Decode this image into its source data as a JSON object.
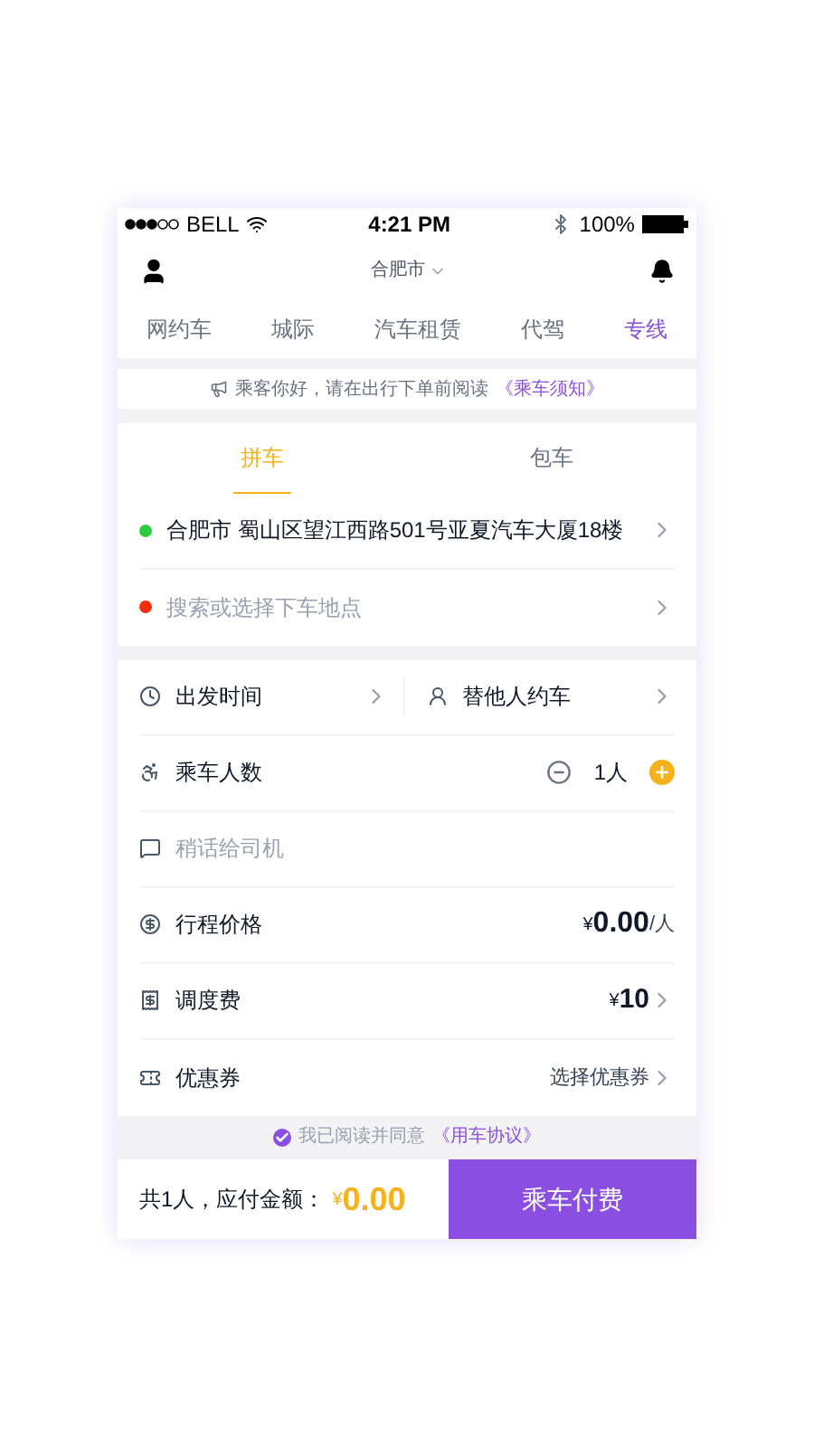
{
  "status_bar": {
    "carrier": "BELL",
    "time": "4:21 PM",
    "battery": "100%"
  },
  "header": {
    "city": "合肥市"
  },
  "service_tabs": [
    {
      "label": "网约车",
      "selected": false
    },
    {
      "label": "城际",
      "selected": false
    },
    {
      "label": "汽车租赁",
      "selected": false
    },
    {
      "label": "代驾",
      "selected": false
    },
    {
      "label": "专线",
      "selected": true
    }
  ],
  "notice": {
    "text": "乘客你好，请在出行下单前阅读",
    "link": "《乘车须知》"
  },
  "ride_tabs": [
    {
      "label": "拼车",
      "selected": true
    },
    {
      "label": "包车",
      "selected": false
    }
  ],
  "route": [
    {
      "text": "合肥市 蜀山区望江西路501号亚夏汽车大厦18楼",
      "placeholder": false,
      "color": "#2ecc40"
    },
    {
      "text": "搜索或选择下车地点",
      "placeholder": true,
      "color": "#f0300a"
    }
  ],
  "options": {
    "departure": "出发时间",
    "for_others": "替他人约车"
  },
  "passengers": {
    "label": "乘车人数",
    "count": "1人"
  },
  "message": {
    "placeholder": "稍话给司机"
  },
  "price": {
    "label": "行程价格",
    "currency": "¥",
    "amount": "0.00",
    "unit": "/人"
  },
  "fee": {
    "label": "调度费",
    "currency": "¥",
    "amount": "10"
  },
  "coupon": {
    "label": "优惠券",
    "value": "选择优惠券"
  },
  "agreement": {
    "checked": true,
    "text": "我已阅读并同意",
    "link": "《用车协议》"
  },
  "footer": {
    "summary": "共1人，应付金额：",
    "currency": "¥",
    "amount": "0.00",
    "button": "乘车付费"
  }
}
